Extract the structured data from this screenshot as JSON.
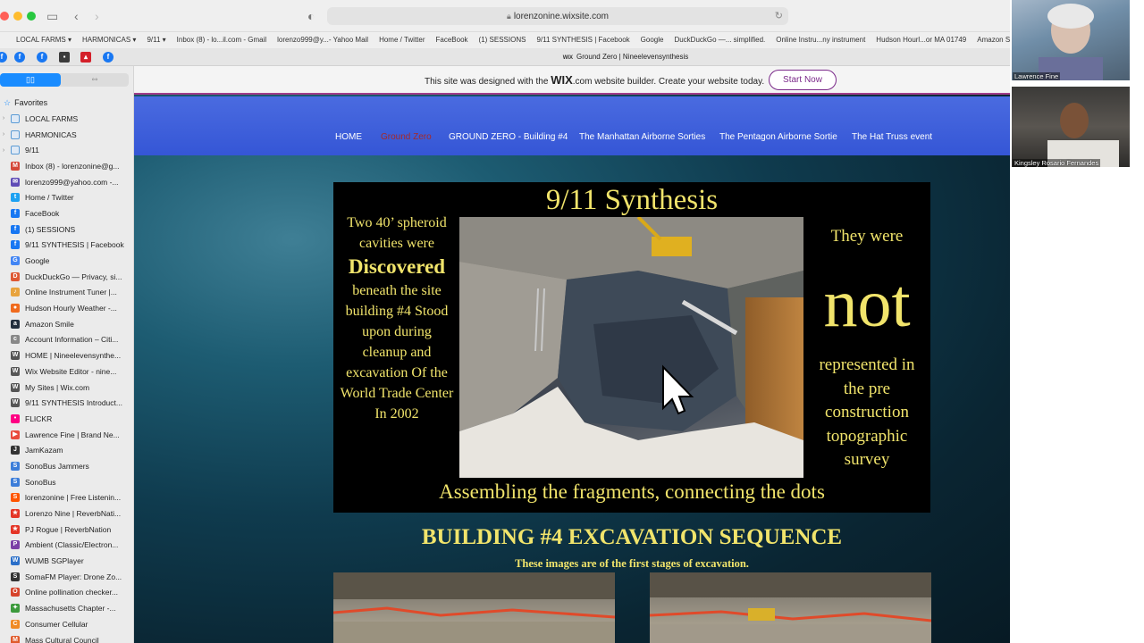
{
  "browser": {
    "url": "lorenzonine.wixsite.com",
    "tab_title": "Ground Zero | Nineelevensynthesis",
    "tab_site_badge": "WIX"
  },
  "bookmarks_bar": [
    "LOCAL FARMS ▾",
    "HARMONICAS ▾",
    "9/11 ▾",
    "Inbox (8) - lo...il.com - Gmail",
    "lorenzo999@y...- Yahoo Mail",
    "Home / Twitter",
    "FaceBook",
    "(1) SESSIONS",
    "9/11 SYNTHESIS | Facebook",
    "Google",
    "DuckDuckGo —... simplified.",
    "Online Instru...ny instrument",
    "Hudson Hourl...or MA 01749",
    "Amazon Smile",
    "A"
  ],
  "sidebar": {
    "favorites_label": "Favorites",
    "items": [
      {
        "label": "LOCAL FARMS",
        "icon": "folder-icon",
        "color": "#5b9bd5",
        "folder": true
      },
      {
        "label": "HARMONICAS",
        "icon": "folder-icon",
        "color": "#5b9bd5",
        "folder": true
      },
      {
        "label": "9/11",
        "icon": "folder-icon",
        "color": "#5b9bd5",
        "folder": true
      },
      {
        "label": "Inbox (8) - lorenzonine@g...",
        "icon": "gmail-icon",
        "color": "#d44638"
      },
      {
        "label": "lorenzo999@yahoo.com -...",
        "icon": "mail-icon",
        "color": "#5f4bb6"
      },
      {
        "label": "Home / Twitter",
        "icon": "twitter-icon",
        "color": "#1da1f2"
      },
      {
        "label": "FaceBook",
        "icon": "facebook-icon",
        "color": "#1877f2"
      },
      {
        "label": "(1) SESSIONS",
        "icon": "facebook-icon",
        "color": "#1877f2"
      },
      {
        "label": "9/11 SYNTHESIS | Facebook",
        "icon": "facebook-icon",
        "color": "#1877f2"
      },
      {
        "label": "Google",
        "icon": "google-icon",
        "color": "#4285f4"
      },
      {
        "label": "DuckDuckGo — Privacy, si...",
        "icon": "duckduckgo-icon",
        "color": "#de5833"
      },
      {
        "label": "Online Instrument Tuner |...",
        "icon": "tuner-icon",
        "color": "#e8a33d"
      },
      {
        "label": "Hudson Hourly Weather -...",
        "icon": "weather-icon",
        "color": "#f06a1d"
      },
      {
        "label": "Amazon Smile",
        "icon": "amazon-icon",
        "color": "#232f3e"
      },
      {
        "label": "Account Information – Citi...",
        "icon": "citi-icon",
        "color": "#888888"
      },
      {
        "label": "HOME | Nineelevensynthe...",
        "icon": "wix-icon",
        "color": "#555555"
      },
      {
        "label": "Wix Website Editor - nine...",
        "icon": "wix-icon",
        "color": "#555555"
      },
      {
        "label": "My Sites | Wix.com",
        "icon": "wix-icon",
        "color": "#555555"
      },
      {
        "label": "9/11 SYNTHESIS Introduct...",
        "icon": "wix-icon",
        "color": "#555555"
      },
      {
        "label": "FLICKR",
        "icon": "flickr-icon",
        "color": "#ff0084"
      },
      {
        "label": "Lawrence Fine | Brand Ne...",
        "icon": "play-icon",
        "color": "#e94b3c"
      },
      {
        "label": "JamKazam",
        "icon": "jamkazam-icon",
        "color": "#333333"
      },
      {
        "label": "SonoBus Jammers",
        "icon": "sonobus-icon",
        "color": "#3c7dd9"
      },
      {
        "label": "SonoBus",
        "icon": "sonobus-icon",
        "color": "#3c7dd9"
      },
      {
        "label": "lorenzonine | Free Listenin...",
        "icon": "soundcloud-icon",
        "color": "#ff5500"
      },
      {
        "label": "Lorenzo Nine | ReverbNati...",
        "icon": "reverbnation-icon",
        "color": "#e43526"
      },
      {
        "label": "PJ Rogue | ReverbNation",
        "icon": "reverbnation-icon",
        "color": "#e43526"
      },
      {
        "label": "Ambient (Classic/Electron...",
        "icon": "ambient-icon",
        "color": "#7b3fa6"
      },
      {
        "label": "WUMB SGPlayer",
        "icon": "radio-icon",
        "color": "#2a6fc9"
      },
      {
        "label": "SomaFM Player: Drone Zo...",
        "icon": "somafm-icon",
        "color": "#333333"
      },
      {
        "label": "Online pollination checker...",
        "icon": "pollination-icon",
        "color": "#d6432b"
      },
      {
        "label": "Massachusetts Chapter -...",
        "icon": "leaf-icon",
        "color": "#3c9a3c"
      },
      {
        "label": "Consumer Cellular",
        "icon": "cellular-icon",
        "color": "#f08a24"
      },
      {
        "label": "Mass Cultural Council",
        "icon": "council-icon",
        "color": "#e05a2b"
      }
    ]
  },
  "wix_banner": {
    "text_before": "This site was designed with the",
    "brand": "WIX",
    "text_after": ".com website builder. Create your website today.",
    "cta": "Start Now"
  },
  "nav": [
    {
      "label": "HOME",
      "active": false
    },
    {
      "label": "Ground Zero",
      "active": true
    },
    {
      "label": "GROUND ZERO - Building #4",
      "active": false
    },
    {
      "label": "The Manhattan Airborne Sorties",
      "active": false
    },
    {
      "label": "The Pentagon Airborne Sortie",
      "active": false
    },
    {
      "label": "The Hat Truss event",
      "active": false
    }
  ],
  "hero": {
    "title": "9/11 Synthesis",
    "left_top": "Two 40’ spheroid cavities were",
    "left_emph": "Discovered",
    "left_bottom": "beneath the site building #4 Stood upon during cleanup and excavation Of the World Trade Center In 2002",
    "right_top": "They were",
    "right_big": "not",
    "right_bottom": "represented in the pre construction topographic survey",
    "footer": "Assembling the fragments, connecting the dots"
  },
  "section": {
    "title": "BUILDING #4 EXCAVATION SEQUENCE",
    "subtitle": "These images are of the first stages of excavation."
  },
  "video_call": {
    "participant_1": "Lawrence Fine",
    "participant_2": "Kingsley Rosario Fernandes"
  },
  "colors": {
    "accent_yellow": "#f1e46b",
    "nav_blue": "#3f60dc",
    "wix_purple": "#7b2a8a"
  }
}
